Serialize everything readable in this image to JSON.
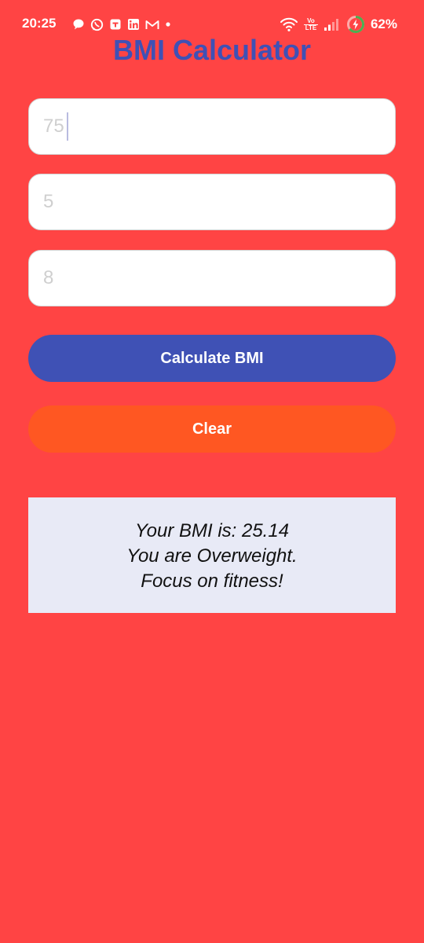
{
  "status_bar": {
    "time": "20:25",
    "notification_icons": [
      "chat-bubble-icon",
      "whatsapp-icon",
      "teams-icon",
      "linkedin-icon",
      "gmail-icon",
      "dot-icon"
    ],
    "volte_top": "Vo",
    "volte_bottom": "LTE",
    "battery_percent": "62%"
  },
  "app": {
    "title": "BMI Calculator"
  },
  "form": {
    "weight_value": "75",
    "feet_placeholder": "5",
    "inches_placeholder": "8"
  },
  "buttons": {
    "calculate_label": "Calculate BMI",
    "clear_label": "Clear"
  },
  "result": {
    "line1": "Your BMI is: 25.14",
    "line2": "You are Overweight.",
    "line3": "Focus on fitness!"
  },
  "colors": {
    "background": "#FF4444",
    "title": "#3F51B5",
    "calculate_button": "#3F51B5",
    "clear_button": "#FF5722",
    "result_card": "#E8EAF6"
  }
}
